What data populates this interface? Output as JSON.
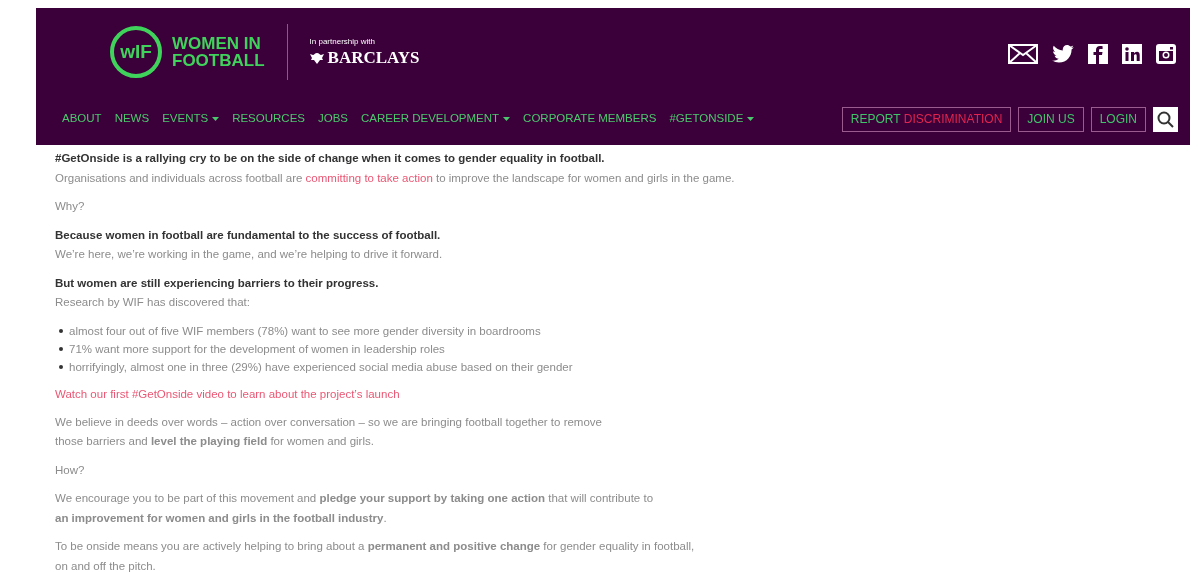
{
  "header": {
    "logo": {
      "mark": "wIF",
      "line_1": "WOMEN IN",
      "line_2": "FOOTBALL"
    },
    "partner": {
      "caption": "In partnership with",
      "name": "BARCLAYS"
    },
    "nav": [
      {
        "label": "ABOUT",
        "dropdown": false
      },
      {
        "label": "NEWS",
        "dropdown": false
      },
      {
        "label": "EVENTS",
        "dropdown": true
      },
      {
        "label": "RESOURCES",
        "dropdown": false
      },
      {
        "label": "JOBS",
        "dropdown": false
      },
      {
        "label": "CAREER DEVELOPMENT",
        "dropdown": true
      },
      {
        "label": "CORPORATE MEMBERS",
        "dropdown": false
      },
      {
        "label": "#GETONSIDE",
        "dropdown": true
      }
    ],
    "actions": [
      {
        "kind": "report",
        "parts": [
          "REPORT",
          "DISCRIMINATION"
        ]
      },
      {
        "kind": "plain",
        "parts": [
          "JOIN US"
        ]
      },
      {
        "kind": "plain",
        "parts": [
          "LOGIN"
        ]
      }
    ]
  },
  "content": [
    {
      "lines": [
        {
          "kind": "bold",
          "text": "#GetOnside is a rallying cry to be on the side of change when it comes to gender equality in football."
        },
        {
          "kind": "body",
          "text": "Organisations and individuals across football are ",
          "link": "committing to take action",
          "after": " to improve the landscape for women and girls in the game."
        }
      ]
    },
    {
      "lines": [
        {
          "kind": "body",
          "text": "Why?"
        }
      ]
    },
    {
      "lines": [
        {
          "kind": "bold",
          "text": "Because women in football are fundamental to the success of football."
        },
        {
          "kind": "body",
          "text": "We’re here, we’re working in the game, and we’re helping to drive it forward."
        }
      ]
    },
    {
      "lines": [
        {
          "kind": "bold",
          "text": "But women are still experiencing barriers to their progress."
        },
        {
          "kind": "body",
          "text": "Research by WIF has discovered that:"
        }
      ]
    },
    {
      "lines": [
        {
          "kind": "bullet",
          "text": "almost four out of five WIF members (78%) want to see more gender diversity in boardrooms"
        },
        {
          "kind": "bullet",
          "text": "71% want more support for the development of women in leadership roles"
        },
        {
          "kind": "bullet",
          "text": "horrifyingly, almost one in three (29%) have experienced social media abuse based on their gender"
        }
      ]
    },
    {
      "lines": [
        {
          "kind": "link",
          "text": "Watch our first #GetOnside video to learn about the project’s launch"
        }
      ]
    },
    {
      "lines": [
        {
          "kind": "body",
          "text": "We believe in deeds over words – action over conversation – so we are bringing football together to remove\nthose barriers and **level the playing field** for women and girls."
        }
      ]
    },
    {
      "lines": [
        {
          "kind": "body",
          "text": "How?"
        }
      ]
    },
    {
      "lines": [
        {
          "kind": "body",
          "text": "We encourage you to be part of this movement and **pledge your support by taking one action** that will contribute to\n**an improvement for women and girls in the football industry**."
        }
      ]
    },
    {
      "lines": [
        {
          "kind": "body",
          "text": "To be onside means you are actively helping to bring about a **permanent and positive change** for gender equality in football,\non and off the pitch."
        }
      ]
    }
  ]
}
